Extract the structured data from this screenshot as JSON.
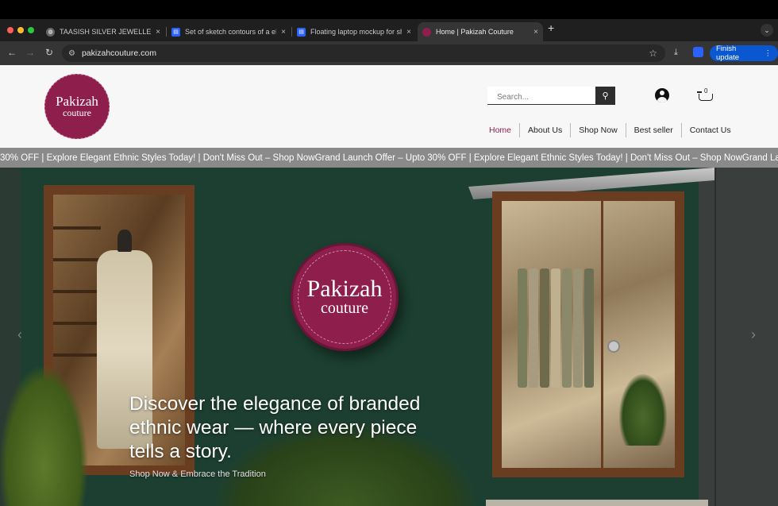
{
  "browser": {
    "tabs": [
      {
        "title": "TAASISH SILVER JEWELLERY – ",
        "active": false
      },
      {
        "title": "Set of sketch contours of a el",
        "active": false
      },
      {
        "title": "Floating laptop mockup for sh",
        "active": false
      },
      {
        "title": "Home | Pakizah Couture",
        "active": true
      }
    ],
    "close_glyph": "×",
    "new_tab_glyph": "+",
    "url": "pakizahcouture.com",
    "finish_update": "Finish update",
    "colors": {
      "accent": "#0b57d0",
      "tabbar": "#1f1f1f",
      "toolbar": "#353535"
    }
  },
  "site": {
    "logo": {
      "line1": "Pakizah",
      "line2": "couture"
    },
    "search_placeholder": "Search...",
    "cart_count": "0",
    "nav": [
      {
        "label": "Home",
        "active": true
      },
      {
        "label": "About Us",
        "active": false
      },
      {
        "label": "Shop Now",
        "active": false
      },
      {
        "label": "Best seller",
        "active": false
      },
      {
        "label": "Contact Us",
        "active": false
      }
    ],
    "ticker": "30% OFF  |  Explore Elegant Ethnic Styles Today!  |  Don't Miss Out – Shop NowGrand Launch Offer – Upto 30% OFF  |  Explore Elegant Ethnic Styles Today!  |  Don't Miss Out – Shop NowGrand La",
    "hero": {
      "sign_line1": "Pakizah",
      "sign_line2": "couture",
      "headline": "Discover the elegance of branded ethnic wear — where every piece tells a story.",
      "subline": "Shop Now & Embrace the Tradition"
    },
    "colors": {
      "brand": "#8e1f4c",
      "wall": "#1c3f31",
      "ticker_bg": "#8a8a8a"
    }
  }
}
